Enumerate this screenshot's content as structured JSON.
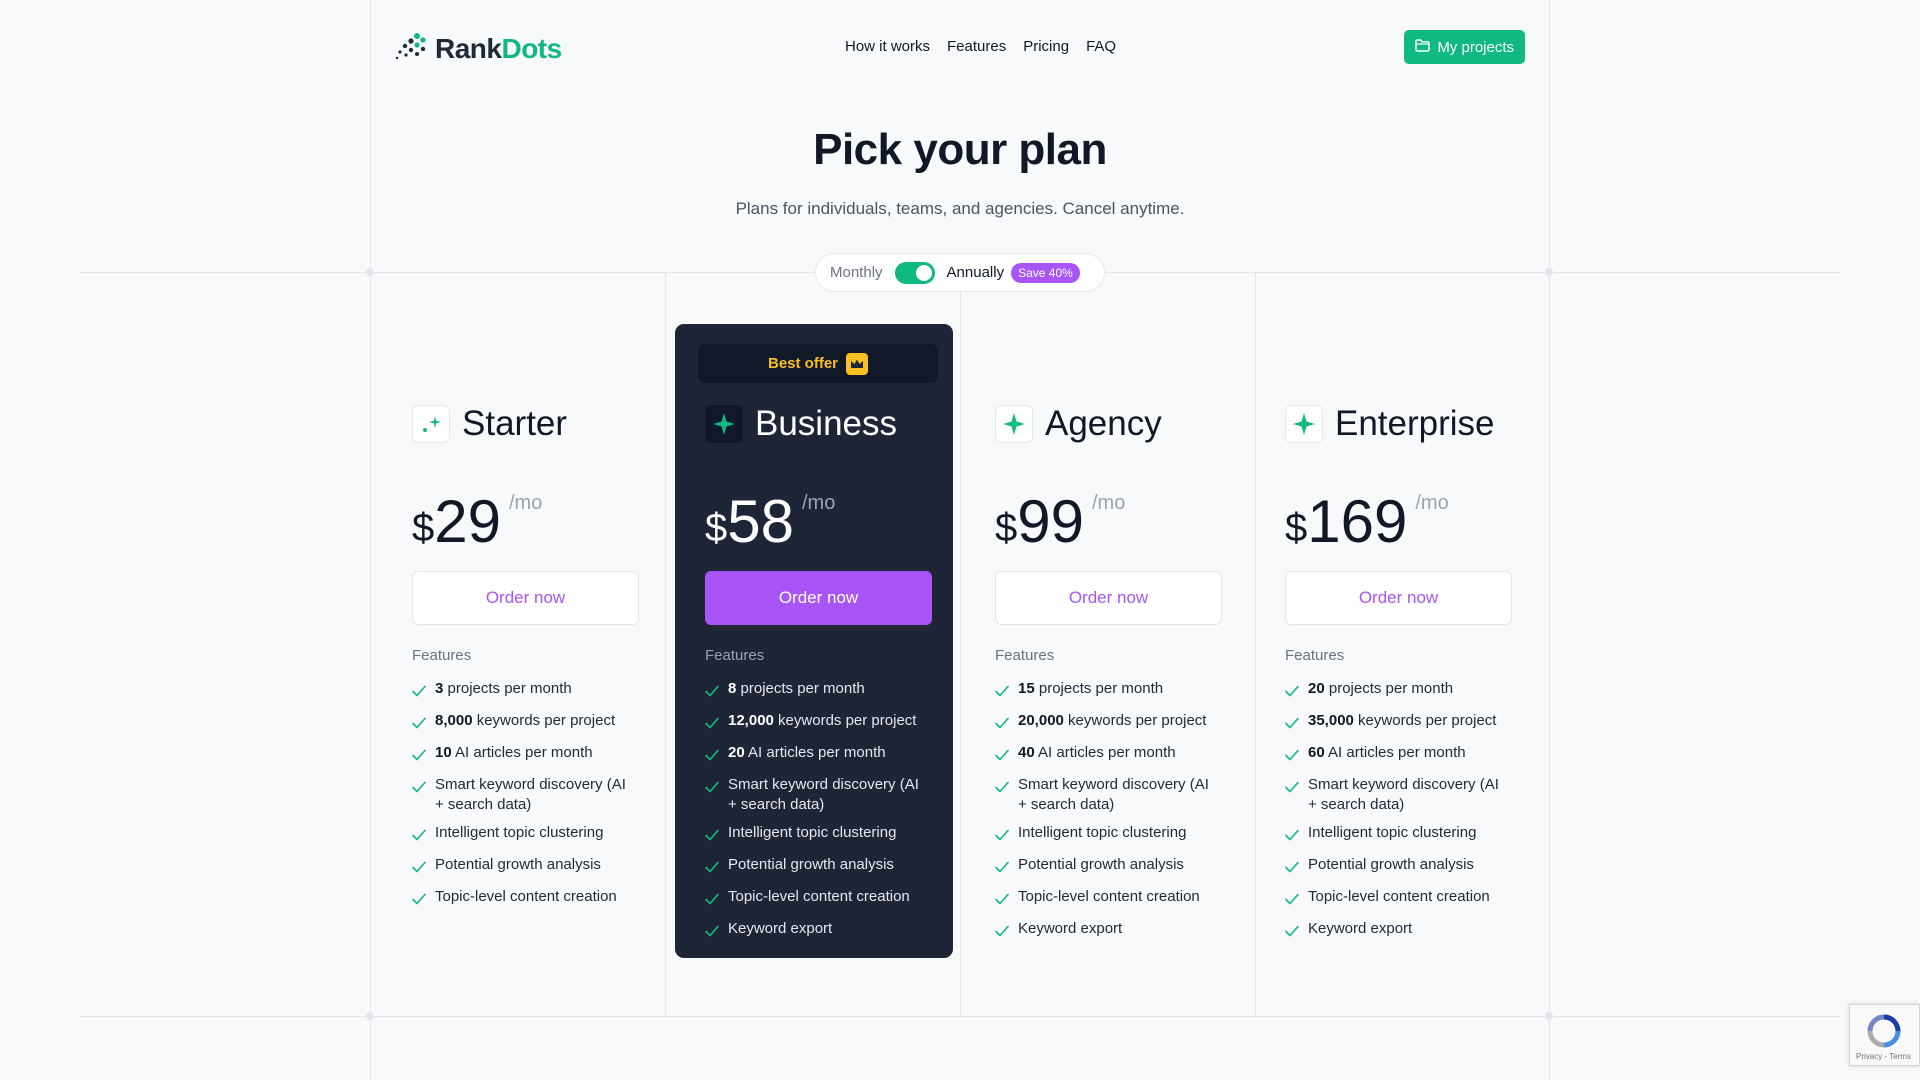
{
  "brand": {
    "name_part1": "Rank",
    "name_part2": "Dots"
  },
  "nav": {
    "items": [
      "How it works",
      "Features",
      "Pricing",
      "FAQ"
    ]
  },
  "header": {
    "my_projects_label": "My projects"
  },
  "hero": {
    "title": "Pick your plan",
    "subtitle": "Plans for individuals, teams, and agencies. Cancel anytime."
  },
  "billing_toggle": {
    "monthly_label": "Monthly",
    "annually_label": "Annually",
    "save_badge": "Save 40%",
    "selected": "annually"
  },
  "features_heading": "Features",
  "order_label": "Order now",
  "currency": "$",
  "per_label": "/mo",
  "best_offer_label": "Best offer",
  "plans": [
    {
      "name": "Starter",
      "price": "29",
      "highlight": false,
      "features": [
        {
          "bold": "3",
          "text": " projects per month"
        },
        {
          "bold": "8,000",
          "text": " keywords per project"
        },
        {
          "bold": "10",
          "text": " AI articles per month"
        },
        {
          "bold": "",
          "text": "Smart keyword discovery (AI + search data)"
        },
        {
          "bold": "",
          "text": "Intelligent topic clustering"
        },
        {
          "bold": "",
          "text": "Potential growth analysis"
        },
        {
          "bold": "",
          "text": "Topic-level content creation"
        }
      ]
    },
    {
      "name": "Business",
      "price": "58",
      "highlight": true,
      "features": [
        {
          "bold": "8",
          "text": " projects per month"
        },
        {
          "bold": "12,000",
          "text": " keywords per project"
        },
        {
          "bold": "20",
          "text": " AI articles per month"
        },
        {
          "bold": "",
          "text": "Smart keyword discovery (AI + search data)"
        },
        {
          "bold": "",
          "text": "Intelligent topic clustering"
        },
        {
          "bold": "",
          "text": "Potential growth analysis"
        },
        {
          "bold": "",
          "text": "Topic-level content creation"
        },
        {
          "bold": "",
          "text": "Keyword export"
        }
      ]
    },
    {
      "name": "Agency",
      "price": "99",
      "highlight": false,
      "features": [
        {
          "bold": "15",
          "text": " projects per month"
        },
        {
          "bold": "20,000",
          "text": " keywords per project"
        },
        {
          "bold": "40",
          "text": " AI articles per month"
        },
        {
          "bold": "",
          "text": "Smart keyword discovery (AI + search data)"
        },
        {
          "bold": "",
          "text": "Intelligent topic clustering"
        },
        {
          "bold": "",
          "text": "Potential growth analysis"
        },
        {
          "bold": "",
          "text": "Topic-level content creation"
        },
        {
          "bold": "",
          "text": "Keyword export"
        }
      ]
    },
    {
      "name": "Enterprise",
      "price": "169",
      "highlight": false,
      "features": [
        {
          "bold": "20",
          "text": " projects per month"
        },
        {
          "bold": "35,000",
          "text": " keywords per project"
        },
        {
          "bold": "60",
          "text": " AI articles per month"
        },
        {
          "bold": "",
          "text": "Smart keyword discovery (AI + search data)"
        },
        {
          "bold": "",
          "text": "Intelligent topic clustering"
        },
        {
          "bold": "",
          "text": "Potential growth analysis"
        },
        {
          "bold": "",
          "text": "Topic-level content creation"
        },
        {
          "bold": "",
          "text": "Keyword export"
        }
      ]
    }
  ],
  "recaptcha": {
    "links": "Privacy - Terms"
  },
  "colors": {
    "brand_green": "#10b981",
    "accent_purple": "#a855f7",
    "dark_card": "#1e2536",
    "gold": "#fbbf24"
  },
  "icons": [
    "logo-dots-icon",
    "folder-icon",
    "sparkle-icon",
    "check-icon",
    "crown-icon",
    "recaptcha-icon"
  ]
}
